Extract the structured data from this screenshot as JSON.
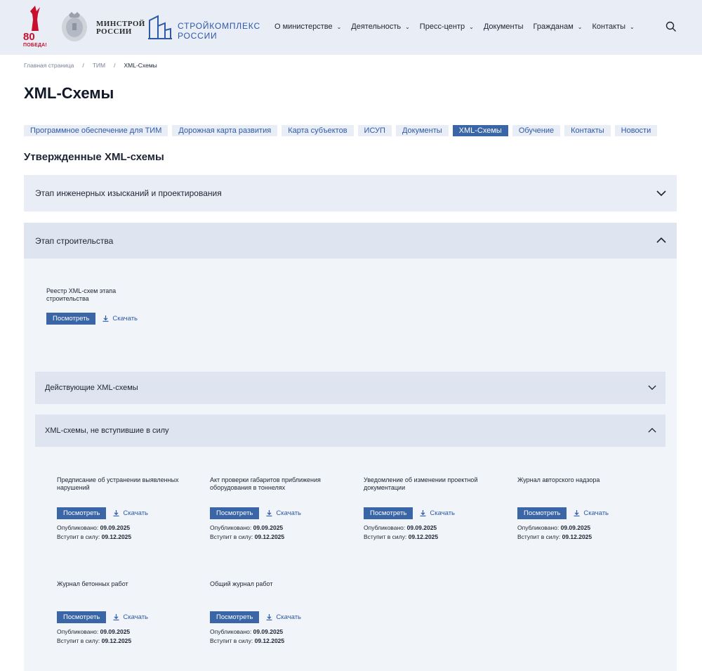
{
  "header": {
    "logo_80": {
      "number": "80",
      "caption": "ПОБЕДА!"
    },
    "ministry_line1": "МИНСТРОЙ",
    "ministry_line2": "РОССИИ",
    "complex_line1": "СТРОЙКОМПЛЕКС",
    "complex_line2": "РОССИИ",
    "nav": [
      {
        "label": "О министерстве",
        "dropdown": true
      },
      {
        "label": "Деятельность",
        "dropdown": true
      },
      {
        "label": "Пресс-центр",
        "dropdown": true
      },
      {
        "label": "Документы",
        "dropdown": false
      },
      {
        "label": "Гражданам",
        "dropdown": true
      },
      {
        "label": "Контакты",
        "dropdown": true
      }
    ],
    "search_icon": "search-icon"
  },
  "breadcrumb": [
    "Главная страница",
    "ТИМ",
    "XML-Схемы"
  ],
  "page_title": "XML-Схемы",
  "tabs": [
    {
      "label": "Программное обеспечение для ТИМ",
      "active": false
    },
    {
      "label": "Дорожная карта развития",
      "active": false
    },
    {
      "label": "Карта субъектов",
      "active": false
    },
    {
      "label": "ИСУП",
      "active": false
    },
    {
      "label": "Документы",
      "active": false
    },
    {
      "label": "XML-Схемы",
      "active": true
    },
    {
      "label": "Обучение",
      "active": false
    },
    {
      "label": "Контакты",
      "active": false
    },
    {
      "label": "Новости",
      "active": false
    }
  ],
  "section_title": "Утвержденные XML-схемы",
  "accordions": {
    "survey": {
      "title": "Этап инженерных изысканий и проектирования",
      "expanded": false
    },
    "construction": {
      "title": "Этап строительства",
      "expanded": true,
      "registry": {
        "name": "Реестр XML-схем этапа строительства",
        "view_label": "Посмотреть",
        "download_label": "Скачать"
      },
      "active_schemas": {
        "title": "Действующие XML-схемы",
        "expanded": false
      },
      "pending_schemas": {
        "title": "XML-схемы, не вступившие в силу",
        "expanded": true,
        "published_label": "Опубликовано:",
        "effective_label": "Вступит в силу:",
        "view_label": "Посмотреть",
        "download_label": "Скачать",
        "items": [
          {
            "name": "Предписание об устранении выявленных нарушений",
            "published": "09.09.2025",
            "effective": "09.12.2025"
          },
          {
            "name": "Акт проверки габаритов приближения оборудования в тоннелях",
            "published": "09.09.2025",
            "effective": "09.12.2025"
          },
          {
            "name": "Уведомление об изменении проектной документации",
            "published": "09.09.2025",
            "effective": "09.12.2025"
          },
          {
            "name": "Журнал авторского надзора",
            "published": "09.09.2025",
            "effective": "09.12.2025"
          },
          {
            "name": "Журнал бетонных работ",
            "published": "09.09.2025",
            "effective": "09.12.2025"
          },
          {
            "name": "Общий журнал работ",
            "published": "09.09.2025",
            "effective": "09.12.2025"
          }
        ]
      }
    }
  },
  "colors": {
    "accent": "#3a66a8",
    "link": "#2d59a8",
    "panel": "#e9edf5",
    "logo_red": "#c8102e"
  }
}
